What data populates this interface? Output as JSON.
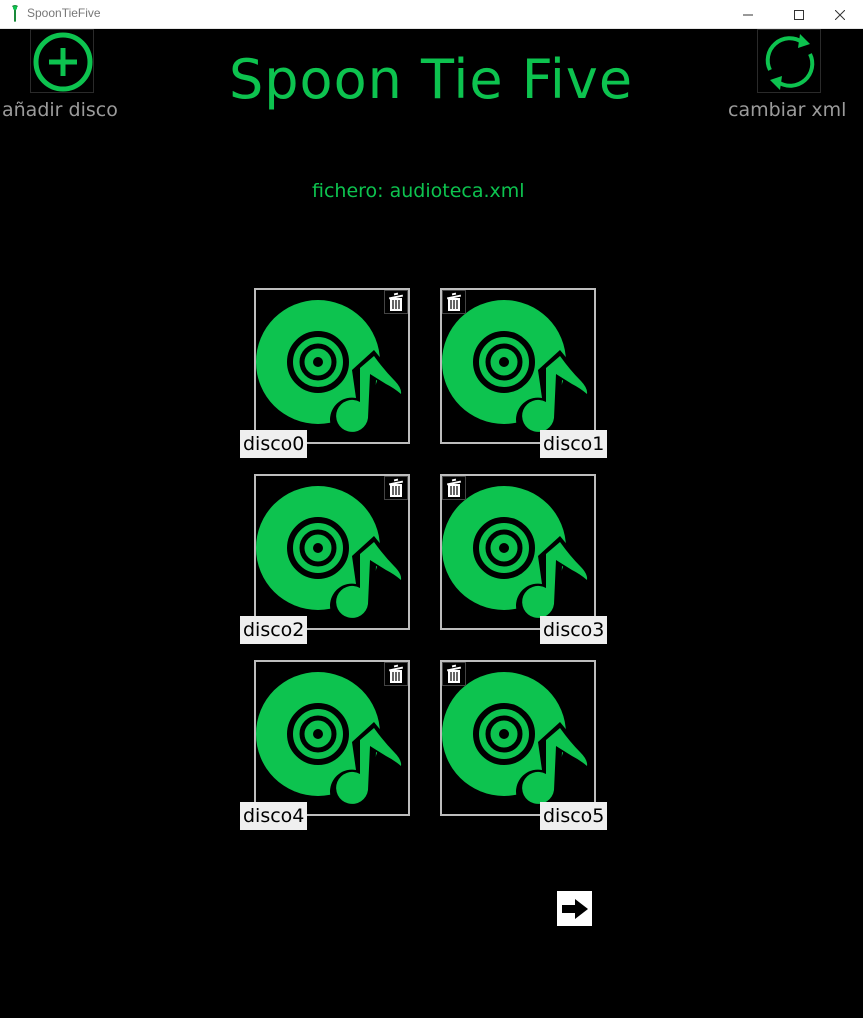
{
  "window": {
    "title": "SpoonTieFive"
  },
  "header": {
    "title": "Spoon Tie Five",
    "add_label": "añadir disco",
    "change_label": "cambiar xml"
  },
  "file": {
    "label": "fichero: audioteca.xml"
  },
  "discs": [
    {
      "label": "disco0"
    },
    {
      "label": "disco1"
    },
    {
      "label": "disco2"
    },
    {
      "label": "disco3"
    },
    {
      "label": "disco4"
    },
    {
      "label": "disco5"
    }
  ],
  "colors": {
    "accent": "#0dc34f",
    "background": "#000000",
    "muted": "#9b9b9b"
  },
  "icons": {
    "add": "plus-circle-icon",
    "change": "refresh-icon",
    "disc": "music-disc-icon",
    "delete": "trash-icon",
    "next": "arrow-right-icon"
  }
}
